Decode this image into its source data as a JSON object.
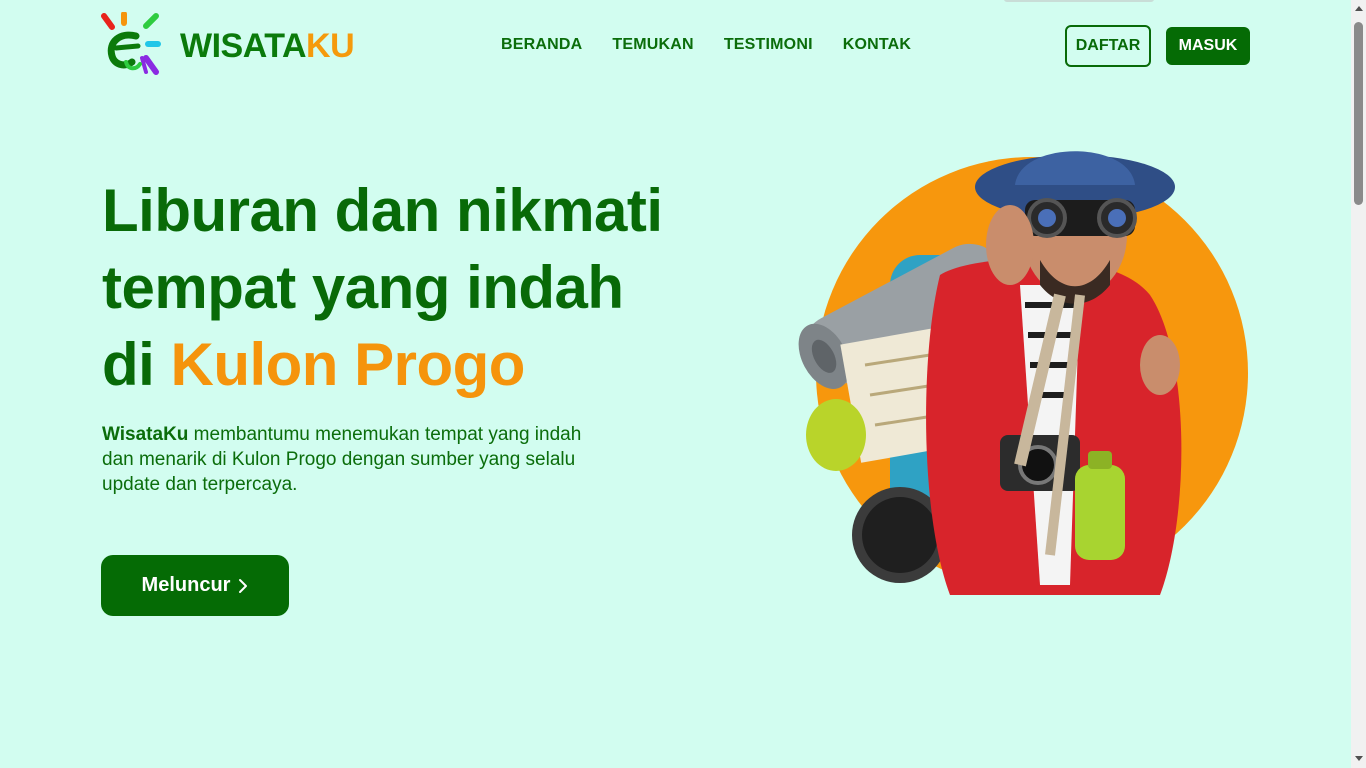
{
  "brand": {
    "name_part1": "WISATA",
    "name_part2": "KU"
  },
  "nav": {
    "items": [
      "BERANDA",
      "TEMUKAN",
      "TESTIMONI",
      "KONTAK"
    ]
  },
  "auth": {
    "register_label": "DAFTAR",
    "login_label": "MASUK"
  },
  "hero": {
    "title_line1": "Liburan dan nikmati",
    "title_line2": "tempat yang indah",
    "title_line3_prefix": "di ",
    "title_highlight": "Kulon Progo",
    "desc_brand": "WisataKu",
    "desc_text": " membantumu menemukan tempat yang indah dan menarik di Kulon Progo dengan sumber yang selalu update dan terpercaya.",
    "cta_label": "Meluncur"
  },
  "colors": {
    "primary": "#056b05",
    "accent": "#f5940c",
    "background": "#d2fdf0"
  },
  "icons": {
    "cta_icon": "chevron-right-icon",
    "logo_icon": "sun-smile-icon"
  }
}
